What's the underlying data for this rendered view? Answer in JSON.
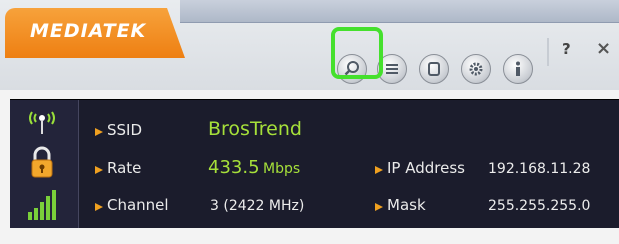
{
  "app": {
    "logo": "MEDIATEK"
  },
  "toolbar": {
    "buttons": [
      {
        "name": "search-button",
        "icon": "search-icon"
      },
      {
        "name": "list-button",
        "icon": "list-icon"
      },
      {
        "name": "page-button",
        "icon": "page-icon"
      },
      {
        "name": "settings-button",
        "icon": "gear-icon"
      },
      {
        "name": "info-button",
        "icon": "info-icon"
      }
    ],
    "help_label": "?",
    "close_label": "×",
    "highlight_color": "#45e02d"
  },
  "status": {
    "ssid_label": "SSID",
    "ssid_value": "BrosTrend",
    "rate_label": "Rate",
    "rate_value": "433.5",
    "rate_unit": "Mbps",
    "channel_label": "Channel",
    "channel_value": "3 (2422 MHz)",
    "ip_label": "IP Address",
    "ip_value": "192.168.11.28",
    "mask_label": "Mask",
    "mask_value": "255.255.255.0",
    "icons": [
      "antenna-icon",
      "lock-icon",
      "signal-bars-icon"
    ],
    "accent_color": "#a6e03a",
    "bullet_color": "#f0a020"
  }
}
